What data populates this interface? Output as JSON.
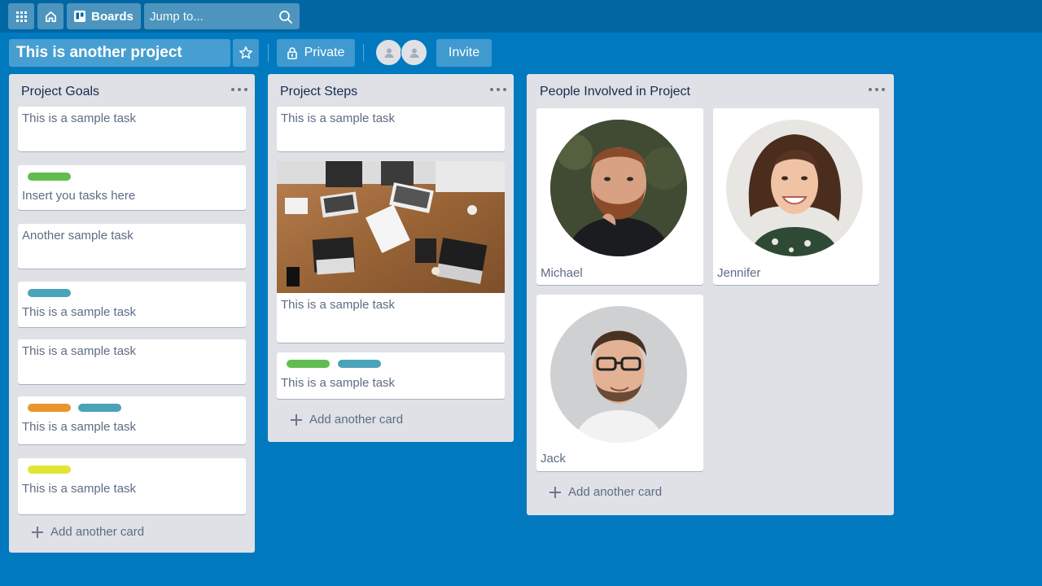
{
  "header": {
    "boards_label": "Boards",
    "search_placeholder": "Jump to..."
  },
  "board": {
    "title": "This is another project",
    "private_label": "Private",
    "invite_label": "Invite"
  },
  "lists": [
    {
      "title": "Project Goals",
      "cards": [
        {
          "text": "This is a sample task",
          "labels": []
        },
        {
          "text": "Insert you tasks here",
          "labels": [
            "#61bd4f"
          ]
        },
        {
          "text": "Another sample task",
          "labels": []
        },
        {
          "text": "This is a sample task",
          "labels": [
            "#4ba3b9"
          ]
        },
        {
          "text": "This is a sample task",
          "labels": []
        },
        {
          "text": "This is a sample task",
          "labels": [
            "#e8962c",
            "#4ba3b9"
          ]
        },
        {
          "text": "This is a sample task",
          "labels": [
            "#e0e533"
          ]
        }
      ],
      "add_label": "Add another card"
    },
    {
      "title": "Project Steps",
      "cards": [
        {
          "text": "This is a sample task",
          "labels": []
        },
        {
          "text": "This is a sample task",
          "labels": [],
          "cover": "office-meeting-photo"
        },
        {
          "text": "This is a sample task",
          "labels": [
            "#61bd4f",
            "#4ba3b9"
          ]
        }
      ],
      "add_label": "Add another card"
    },
    {
      "title": "People Involved in Project",
      "cards": [
        {
          "name": "Michael",
          "photo": "bearded-man-photo"
        },
        {
          "name": "Jennifer",
          "photo": "smiling-woman-photo"
        },
        {
          "name": "Jack",
          "photo": "man-with-glasses-photo"
        }
      ],
      "add_label": "Add another card"
    }
  ]
}
